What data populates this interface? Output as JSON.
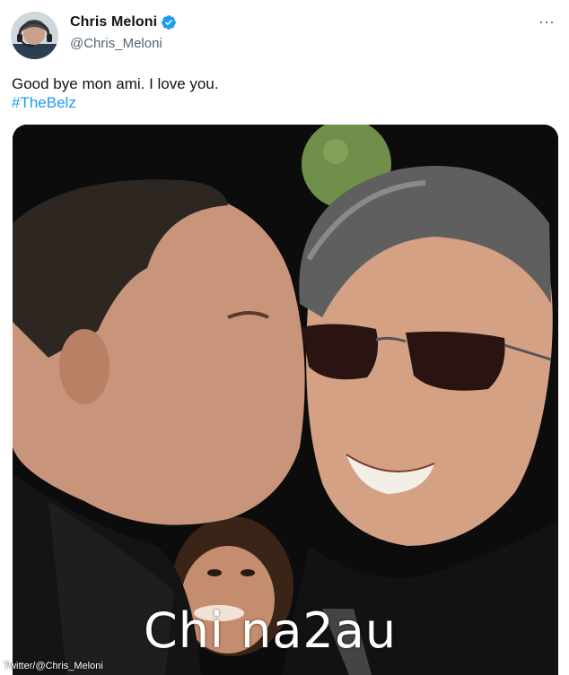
{
  "author": {
    "display_name": "Chris Meloni",
    "handle": "@Chris_Meloni",
    "verified": true,
    "avatar_icon": "user-avatar"
  },
  "menu": {
    "more_icon": "more-horizontal-icon",
    "label": "···"
  },
  "tweet": {
    "text": "Good bye mon ami. I love you.",
    "hashtag": "#TheBelz"
  },
  "media": {
    "credit": "Twitter/@Chris_Meloni",
    "watermark": "Chi na2au"
  },
  "colors": {
    "link": "#1d9bf0",
    "verified_badge": "#1d9bf0",
    "secondary_text": "#536471"
  }
}
